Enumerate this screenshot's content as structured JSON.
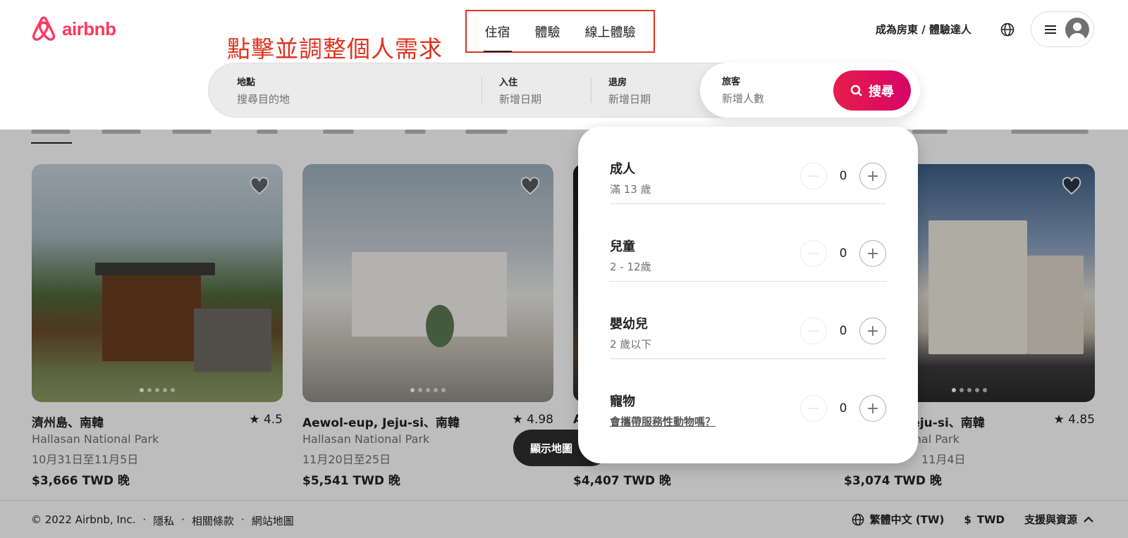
{
  "brand": {
    "name": "airbnb",
    "color": "#FF385C"
  },
  "annotation": {
    "text": "點擊並調整個人需求",
    "color": "#E0321E"
  },
  "header": {
    "tabs": [
      {
        "label": "住宿",
        "active": true
      },
      {
        "label": "體驗",
        "active": false
      },
      {
        "label": "線上體驗",
        "active": false
      }
    ],
    "host_link": "成為房東 / 體驗達人",
    "globe_icon": "globe-icon",
    "menu_icon": "hamburger-icon"
  },
  "search": {
    "location": {
      "label": "地點",
      "placeholder": "搜尋目的地"
    },
    "checkin": {
      "label": "入住",
      "placeholder": "新增日期"
    },
    "checkout": {
      "label": "退房",
      "placeholder": "新增日期"
    },
    "guests": {
      "label": "旅客",
      "placeholder": "新增人數"
    },
    "button": "搜尋"
  },
  "listings": [
    {
      "title": "濟州島、南韓",
      "rating": "4.5",
      "subtitle": "Hallasan National Park",
      "dates": "10月31日至11月5日",
      "price": "$3,666 TWD 晚"
    },
    {
      "title": "Aewol-eup, Jeju-si、南韓",
      "rating": "4.98",
      "subtitle": "Hallasan National Park",
      "dates": "11月20日至25日",
      "price": "$5,541 TWD 晚"
    },
    {
      "title": "A",
      "rating": "",
      "subtitle": "",
      "dates": "",
      "price": "$4,407 TWD 晚"
    },
    {
      "title": "Jeju-si、南韓",
      "rating": "4.85",
      "subtitle": "onal Park",
      "dates": "11月4日",
      "price": "$3,074 TWD 晚"
    }
  ],
  "map_button": "顯示地圖",
  "guest_popup": {
    "rows": [
      {
        "label": "成人",
        "sub": "滿 13 歲",
        "value": "0"
      },
      {
        "label": "兒童",
        "sub": "2 - 12歲",
        "value": "0"
      },
      {
        "label": "嬰幼兒",
        "sub": "2 歲以下",
        "value": "0"
      },
      {
        "label": "寵物",
        "sub": "會攜帶服務性動物嗎？",
        "value": "0"
      }
    ]
  },
  "footer": {
    "copyright": "© 2022 Airbnb, Inc.",
    "sep": "·",
    "links": [
      "隱私",
      "相關條款",
      "網站地圖"
    ],
    "language": "繁體中文 (TW)",
    "currency_symbol": "$",
    "currency": "TWD",
    "support": "支援與資源"
  }
}
